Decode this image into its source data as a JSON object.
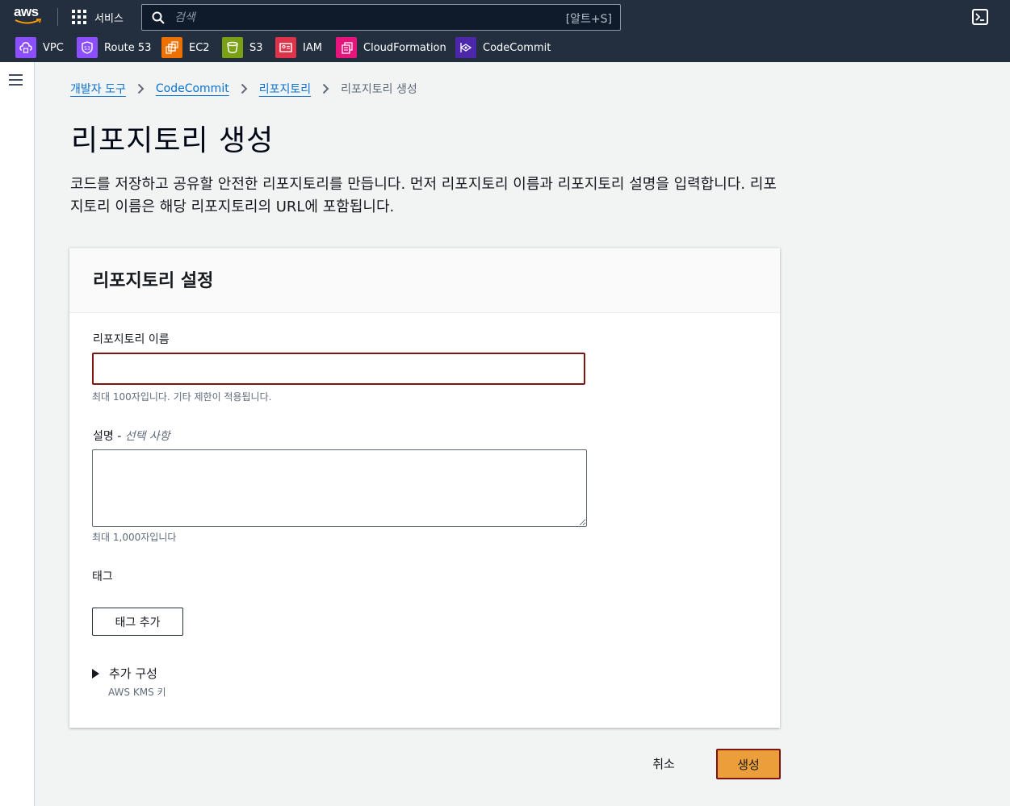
{
  "topnav": {
    "logo_text": "aws",
    "services_label": "서비스",
    "search_placeholder": "검색",
    "search_shortcut": "[알트+S]"
  },
  "favorites": [
    {
      "label": "VPC",
      "icon": "vpc-icon",
      "color": "#8c4fff"
    },
    {
      "label": "Route 53",
      "icon": "route53-icon",
      "color": "#8c4fff"
    },
    {
      "label": "EC2",
      "icon": "ec2-icon",
      "color": "#ed7100"
    },
    {
      "label": "S3",
      "icon": "s3-icon",
      "color": "#7aa116"
    },
    {
      "label": "IAM",
      "icon": "iam-icon",
      "color": "#dd344c"
    },
    {
      "label": "CloudFormation",
      "icon": "cloudformation-icon",
      "color": "#e7157b"
    },
    {
      "label": "CodeCommit",
      "icon": "codecommit-icon",
      "color": "#4d27aa"
    }
  ],
  "breadcrumb": {
    "items": [
      "개발자 도구",
      "CodeCommit",
      "리포지토리"
    ],
    "current": "리포지토리 생성"
  },
  "page": {
    "title": "리포지토리 생성",
    "description": "코드를 저장하고 공유할 안전한 리포지토리를 만듭니다. 먼저 리포지토리 이름과 리포지토리 설명을 입력합니다. 리포지토리 이름은 해당 리포지토리의 URL에 포함됩니다."
  },
  "settings": {
    "title": "리포지토리 설정",
    "name_label": "리포지토리 이름",
    "name_value": "",
    "name_constraint": "최대 100자입니다. 기타 제한이 적용됩니다.",
    "desc_label": "설명 - ",
    "desc_optional": "선택 사항",
    "desc_value": "",
    "desc_constraint": "최대 1,000자입니다",
    "tags_label": "태그",
    "add_tag_button": "태그 추가",
    "additional_config": "추가 구성",
    "additional_config_sub": "AWS KMS 키"
  },
  "actions": {
    "cancel": "취소",
    "create": "생성"
  },
  "colors": {
    "nav_bg": "#232f3e",
    "link": "#0972d3",
    "primary_button": "#ec9e3a",
    "focus_border": "#7d1515"
  }
}
